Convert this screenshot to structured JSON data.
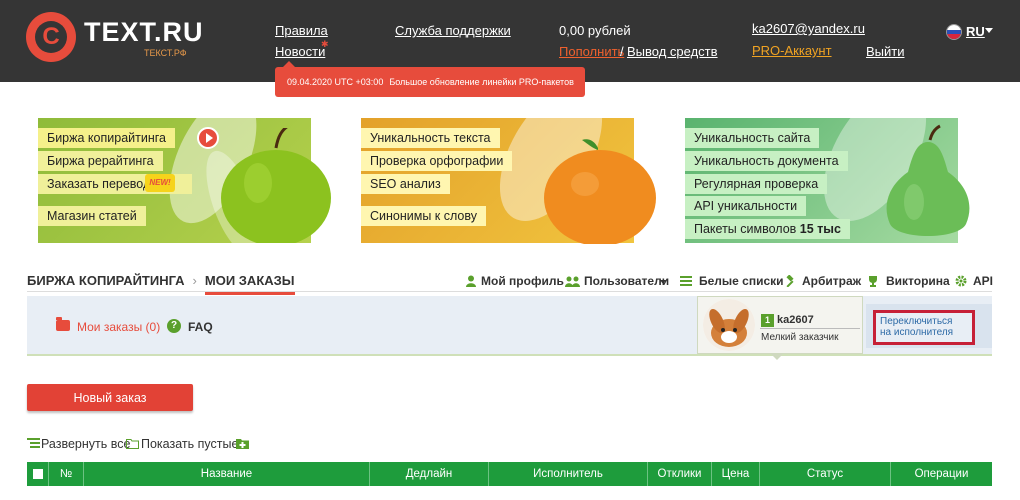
{
  "header": {
    "logo_text": "TEXT.RU",
    "logo_sub": "ТЕКСТ.РФ",
    "rules": "Правила",
    "news": "Новости",
    "support": "Служба поддержки",
    "balance": "0,00 рублей",
    "topup": "Пополнить",
    "slash": "/",
    "withdraw": "Вывод средств",
    "email": "ka2607@yandex.ru",
    "pro_account": "PRO-Аккаунт",
    "logout": "Выйти",
    "language": "RU"
  },
  "news_tooltip": {
    "date": "09.04.2020 UTC +03:00",
    "text": "Большое обновление линейки PRO-пакетов"
  },
  "banners": {
    "green": {
      "items": [
        "Биржа копирайтинга",
        "Биржа рерайтинга",
        "Заказать перевод",
        "Магазин статей"
      ],
      "new_badge": "NEW!"
    },
    "orange": {
      "items": [
        "Уникальность текста",
        "Проверка орфографии",
        "SEO анализ",
        "Синонимы к слову"
      ]
    },
    "pear": {
      "items": [
        "Уникальность сайта",
        "Уникальность документа",
        "Регулярная проверка",
        "API уникальности"
      ],
      "packages_prefix": "Пакеты символов",
      "packages_value": "15 тыс"
    }
  },
  "breadcrumbs": {
    "section": "БИРЖА КОПИРАЙТИНГА",
    "separator": "›",
    "current": "МОИ ЗАКАЗЫ"
  },
  "nav": {
    "profile": "Мой профиль",
    "users": "Пользователи",
    "whitelists": "Белые списки",
    "arbitration": "Арбитраж",
    "quiz": "Викторина",
    "api": "API"
  },
  "orders_bar": {
    "my_orders": "Мои заказы (0)",
    "faq": "FAQ"
  },
  "user": {
    "rank": "1",
    "name": "ka2607",
    "status": "Мелкий заказчик",
    "switch_line1": "Переключиться",
    "switch_line2": "на исполнителя"
  },
  "actions": {
    "new_order": "Новый заказ",
    "expand_all": "Развернуть все",
    "show_empty": "Показать пустые"
  },
  "table": {
    "columns": [
      "№",
      "Название",
      "Дедлайн",
      "Исполнитель",
      "Отклики",
      "Цена",
      "Статус",
      "Операции"
    ]
  },
  "colors": {
    "topbar": "#353535",
    "accent_red": "#e74c3c",
    "table_green": "#1e9c3c"
  }
}
